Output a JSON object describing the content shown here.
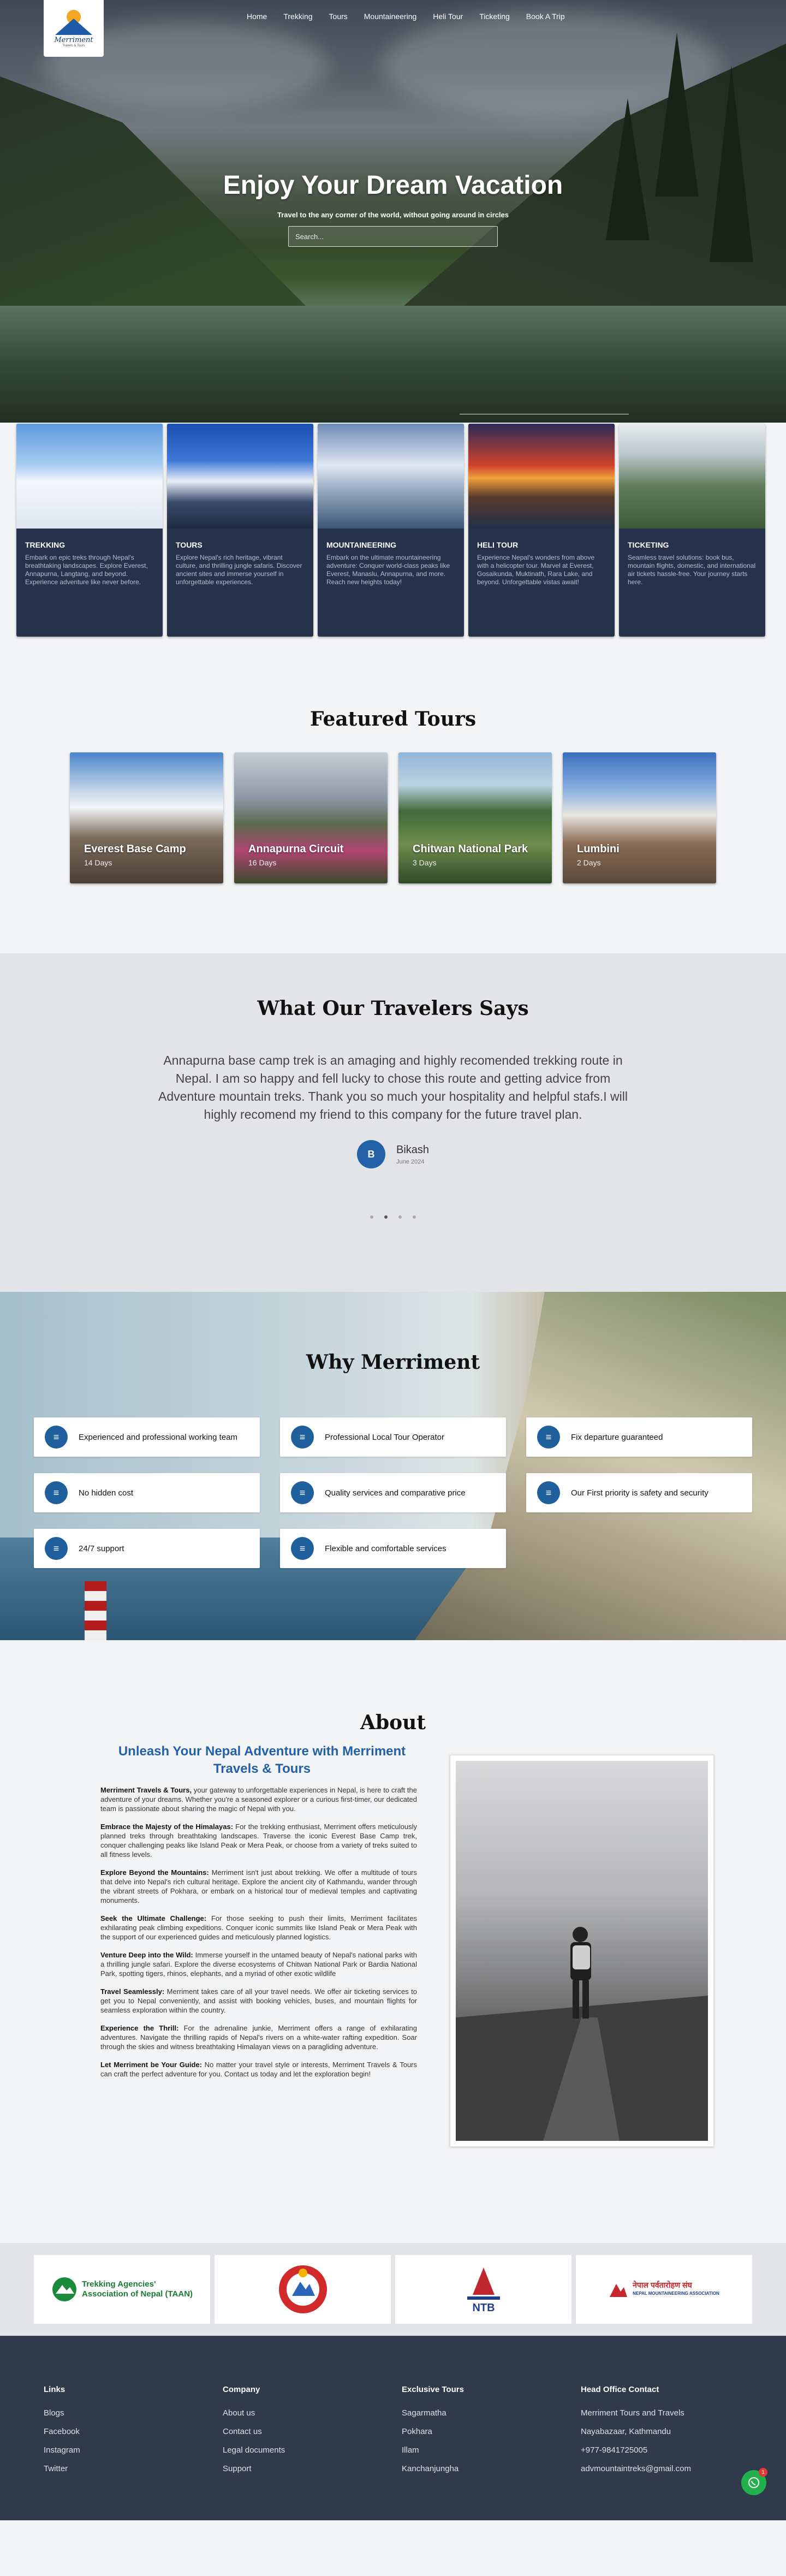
{
  "brand": {
    "name": "Merriment",
    "tagline": "Travels & Tours"
  },
  "nav": [
    "Home",
    "Trekking",
    "Tours",
    "Mountaineering",
    "Heli Tour",
    "Ticketing",
    "Book A Trip"
  ],
  "hero": {
    "title": "Enjoy Your Dream Vacation",
    "subtitle": "Travel to the any corner of the world, without going around in circles",
    "search_placeholder": "Search..."
  },
  "categories": [
    {
      "title": "TREKKING",
      "text": "Embark on epic treks through Nepal's breathtaking landscapes. Explore Everest, Annapurna, Langtang, and beyond. Experience adventure like never before."
    },
    {
      "title": "TOURS",
      "text": "Explore Nepal's rich heritage, vibrant culture, and thrilling jungle safaris. Discover ancient sites and immerse yourself in unforgettable experiences."
    },
    {
      "title": "MOUNTAINEERING",
      "text": "Embark on the ultimate mountaineering adventure: Conquer world-class peaks like Everest, Manaslu, Annapurna, and more. Reach new heights today!"
    },
    {
      "title": "HELI TOUR",
      "text": "Experience Nepal's wonders from above with a helicopter tour. Marvel at Everest, Gosaikunda, Muktinath, Rara Lake, and beyond. Unforgettable vistas await!"
    },
    {
      "title": "TICKETING",
      "text": "Seamless travel solutions: book bus, mountain flights, domestic, and international air tickets hassle-free. Your journey starts here."
    }
  ],
  "featured": {
    "title": "Featured Tours",
    "tours": [
      {
        "name": "Everest Base Camp",
        "days": "14 Days"
      },
      {
        "name": "Annapurna Circuit",
        "days": "16 Days"
      },
      {
        "name": "Chitwan National Park",
        "days": "3 Days"
      },
      {
        "name": "Lumbini",
        "days": "2 Days"
      }
    ]
  },
  "testimonial": {
    "title": "What Our Travelers Says",
    "quote": "Annapurna base camp trek is an amaging and highly recomended trekking route in Nepal. I am so happy and fell lucky to chose this route and getting advice from Adventure mountain treks. Thank you so much your hospitality and helpful stafs.I will highly recomend my friend to this company for the future travel plan.",
    "initial": "B",
    "name": "Bikash",
    "date": "June 2024",
    "dots": 4,
    "active_dot": 2
  },
  "why": {
    "title": "Why Merriment",
    "items": [
      "Experienced and professional working team",
      "Professional Local Tour Operator",
      "Fix departure guaranteed",
      "No hidden cost",
      "Quality services and comparative price",
      "Our First priority is safety and security",
      "24/7 support",
      "Flexible and comfortable services"
    ]
  },
  "about": {
    "title": "About",
    "heading": "Unleash Your Nepal Adventure with Merriment Travels & Tours",
    "paragraphs": [
      {
        "lead": "Merriment Travels & Tours,",
        "text": " your gateway to unforgettable experiences in Nepal, is here to craft the adventure of your dreams. Whether you're a seasoned explorer or a curious first-timer, our dedicated team is passionate about sharing the magic of Nepal with you."
      },
      {
        "lead": "Embrace the Majesty of the Himalayas:",
        "text": " For the trekking enthusiast, Merriment offers meticulously planned treks through breathtaking landscapes. Traverse the iconic Everest Base Camp trek, conquer challenging peaks like Island Peak or Mera Peak, or choose from a variety of treks suited to all fitness levels."
      },
      {
        "lead": "Explore Beyond the Mountains:",
        "text": " Merriment isn't just about trekking. We offer a multitude of tours that delve into Nepal's rich cultural heritage. Explore the ancient city of Kathmandu, wander through the vibrant streets of Pokhara, or embark on a historical tour of medieval temples and captivating monuments."
      },
      {
        "lead": "Seek the Ultimate Challenge:",
        "text": " For those seeking to push their limits, Merriment facilitates exhilarating peak climbing expeditions. Conquer iconic summits like Island Peak or Mera Peak with the support of our experienced guides and meticulously planned logistics."
      },
      {
        "lead": "Venture Deep into the Wild:",
        "text": " Immerse yourself in the untamed beauty of Nepal's national parks with a thrilling jungle safari. Explore the diverse ecosystems of Chitwan National Park or Bardia National Park, spotting tigers, rhinos, elephants, and a myriad of other exotic wildlife"
      },
      {
        "lead": "Travel Seamlessly:",
        "text": " Merriment takes care of all your travel needs. We offer air ticketing services to get you to Nepal conveniently, and assist with booking vehicles, buses, and mountain flights for seamless exploration within the country."
      },
      {
        "lead": "Experience the Thrill:",
        "text": " For the adrenaline junkie, Merriment offers a range of exhilarating adventures. Navigate the thrilling rapids of Nepal's rivers on a white-water rafting expedition. Soar through the skies and witness breathtaking Himalayan views on a paragliding adventure."
      },
      {
        "lead": "Let Merriment be Your Guide:",
        "text": " No matter your travel style or interests, Merriment Travels & Tours can craft the perfect adventure for you. Contact us today and let the exploration begin!"
      }
    ]
  },
  "partners": [
    {
      "line1": "Trekking Agencies'",
      "line2": "Association of Nepal (TAAN)"
    },
    {
      "line1": "",
      "line2": ""
    },
    {
      "line1": "NTB",
      "line2": ""
    },
    {
      "line1": "नेपाल पर्वतारोहण संघ",
      "line2": "NEPAL MOUNTAINEERING ASSOCIATION"
    }
  ],
  "footer": {
    "links": {
      "title": "Links",
      "items": [
        "Blogs",
        "Facebook",
        "Instagram",
        "Twitter"
      ]
    },
    "company": {
      "title": "Company",
      "items": [
        "About us",
        "Contact us",
        "Legal documents",
        "Support"
      ]
    },
    "exclusive": {
      "title": "Exclusive Tours",
      "items": [
        "Sagarmatha",
        "Pokhara",
        "Illam",
        "Kanchanjungha"
      ]
    },
    "office": {
      "title": "Head Office Contact",
      "items": [
        "Merriment Tours and Travels",
        "Nayabazaar, Kathmandu",
        "+977-9841725005",
        "advmountaintreks@gmail.com"
      ]
    },
    "chat_badge": "1"
  },
  "colors": {
    "accent": "#2261a8",
    "card_bg": "#26324a",
    "footer_bg": "#2f3a4a"
  }
}
